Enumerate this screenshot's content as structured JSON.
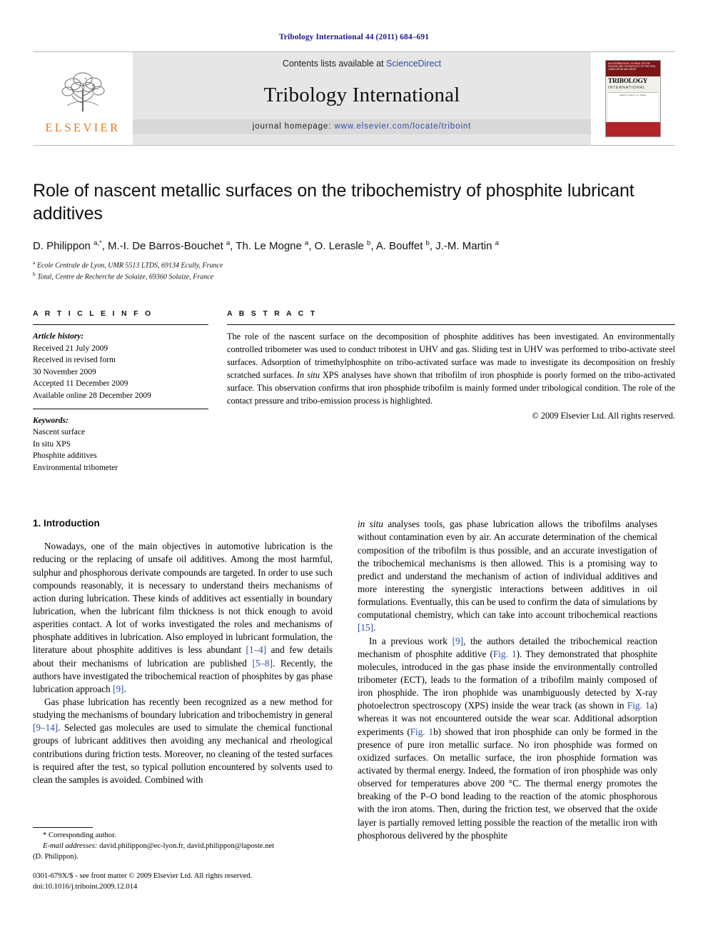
{
  "running_head": "Tribology International 44 (2011) 684–691",
  "masthead": {
    "contents_prefix": "Contents lists available at ",
    "sciencedirect": "ScienceDirect",
    "journal_name": "Tribology International",
    "homepage_prefix": "journal homepage: ",
    "homepage_url": "www.elsevier.com/locate/triboint",
    "publisher_logo_word": "ELSEVIER",
    "cover": {
      "top_text": "AN INTERNATIONAL JOURNAL ON THE SCIENCE AND TECHNOLOGY OF FRICTION, LUBRICATION AND WEAR",
      "title": "TRIBOLOGY",
      "subtitle": "INTERNATIONAL",
      "mid_text": "Editor-in-Chief: H. A. Spikes"
    },
    "accent_color": "#2b4fa2",
    "elsevier_orange": "#e8791c"
  },
  "article": {
    "title": "Role of nascent metallic surfaces on the tribochemistry of phosphite lubricant additives",
    "authors_html": "D. Philippon <sup>a,</sup><sup>*</sup>, M.-I. De Barros-Bouchet <sup>a</sup>, Th. Le Mogne <sup>a</sup>, O. Lerasle <sup>b</sup>, A. Bouffet <sup>b</sup>, J.-M. Martin <sup>a</sup>",
    "affiliation_a": "Ecole Centrale de Lyon, UMR 5513 LTDS, 69134 Ecully, France",
    "affiliation_b": "Total, Centre de Recherche de Solaize, 69360 Solaize, France"
  },
  "article_info": {
    "heading": "A R T I C L E  I N F O",
    "history_label": "Article history:",
    "history_lines": [
      "Received 21 July 2009",
      "Received in revised form",
      "30 November 2009",
      "Accepted 11 December 2009",
      "Available online 28 December 2009"
    ],
    "keywords_label": "Keywords:",
    "keywords": [
      "Nascent surface",
      "In situ XPS",
      "Phosphite additives",
      "Environmental tribometer"
    ]
  },
  "abstract": {
    "heading": "A B S T R A C T",
    "text_html": "The role of the nascent surface on the decomposition of phosphite additives has been investigated. An environmentally controlled tribometer was used to conduct tribotest in UHV and gas. Sliding test in UHV was performed to tribo-activate steel surfaces. Adsorption of trimethylphosphite on tribo-activated surface was made to investigate its decomposition on freshly scratched surfaces. <i>In situ</i> XPS analyses have shown that tribofilm of iron phosphide is poorly formed on the tribo-activated surface. This observation confirms that iron phosphide tribofilm is mainly formed under tribological condition. The role of the contact pressure and tribo-emission process is highlighted.",
    "copyright": "© 2009 Elsevier Ltd. All rights reserved."
  },
  "body": {
    "section_number_title": "1. Introduction",
    "left_paragraphs_html": [
      "Nowadays, one of the main objectives in automotive lubrication is the reducing or the replacing of unsafe oil additives. Among the most harmful, sulphur and phosphorous derivate compounds are targeted. In order to use such compounds reasonably, it is necessary to understand theirs mechanisms of action during lubrication. These kinds of additives act essentially in boundary lubrication, when the lubricant film thickness is not thick enough to avoid asperities contact. A lot of works investigated the roles and mechanisms of phosphate additives in lubrication. Also employed in lubricant formulation, the literature about phosphite additives is less abundant <span class=\"ref\">[1–4]</span> and few details about their mechanisms of lubrication are published <span class=\"ref\">[5–8]</span>. Recently, the authors have investigated the tribochemical reaction of phosphites by gas phase lubrication approach <span class=\"ref\">[9]</span>.",
      "Gas phase lubrication has recently been recognized as a new method for studying the mechanisms of boundary lubrication and tribochemistry in general <span class=\"ref\">[9–14]</span>. Selected gas molecules are used to simulate the chemical functional groups of lubricant additives then avoiding any mechanical and rheological contributions during friction tests. Moreover, no cleaning of the tested surfaces is required after the test, so typical pollution encountered by solvents used to clean the samples is avoided. Combined with"
    ],
    "right_paragraphs_html": [
      "<i>in situ</i> analyses tools, gas phase lubrication allows the tribofilms analyses without contamination even by air. An accurate determination of the chemical composition of the tribofilm is thus possible, and an accurate investigation of the tribochemical mechanisms is then allowed. This is a promising way to predict and understand the mechanism of action of individual additives and more interesting the synergistic interactions between additives in oil formulations. Eventually, this can be used to confirm the data of simulations by computational chemistry, which can take into account tribochemical reactions <span class=\"ref\">[15]</span>.",
      "In a previous work <span class=\"ref\">[9]</span>, the authors detailed the tribochemical reaction mechanism of phosphite additive (<span class=\"ref\">Fig. 1</span>). They demonstrated that phosphite molecules, introduced in the gas phase inside the environmentally controlled tribometer (ECT), leads to the formation of a tribofilm mainly composed of iron phosphide. The iron phophide was unambiguously detected by X-ray photoelectron spectroscopy (XPS) inside the wear track (as shown in <span class=\"ref\">Fig. 1</span>a) whereas it was not encountered outside the wear scar. Additional adsorption experiments (<span class=\"ref\">Fig. 1</span>b) showed that iron phosphide can only be formed in the presence of pure iron metallic surface. No iron phosphide was formed on oxidized surfaces. On metallic surface, the iron phosphide formation was activated by thermal energy. Indeed, the formation of iron phosphide was only observed for temperatures above 200 °C. The thermal energy promotes the breaking of the P–O bond leading to the reaction of the atomic phosphorous with the iron atoms. Then, during the friction test, we observed that the oxide layer is partially removed letting possible the reaction of the metallic iron with phosphorous delivered by the phosphite"
    ],
    "first_paragraph_indent_first_line": "Nowadays,"
  },
  "footnote": {
    "corresponding_marker": "*",
    "corresponding_text": "Corresponding author.",
    "email_label": "E-mail addresses:",
    "emails": "david.philippon@ec-lyon.fr, david.philippon@laposte.net",
    "attribution": "(D. Philippon)."
  },
  "bottom_matter": {
    "issn_line": "0301-679X/$ - see front matter © 2009 Elsevier Ltd. All rights reserved.",
    "doi_line": "doi:10.1016/j.triboint.2009.12.014"
  }
}
